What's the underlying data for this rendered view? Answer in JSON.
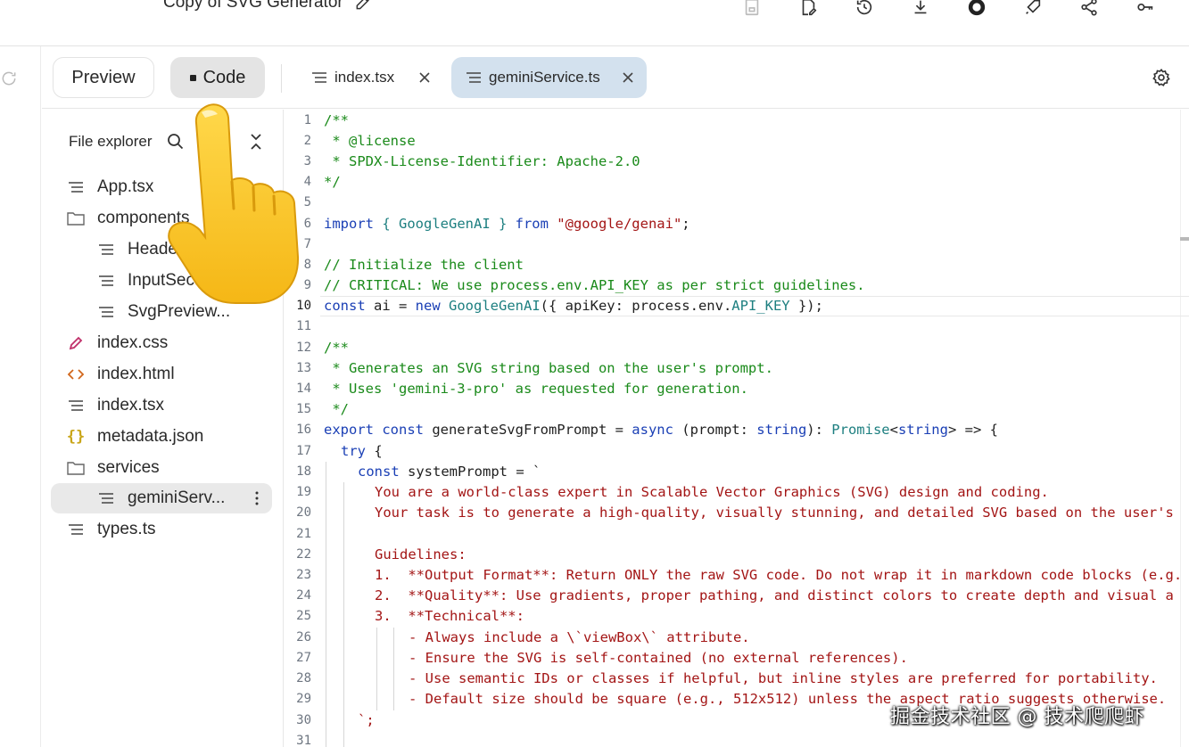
{
  "app": {
    "title": "Copy of SVG Generator",
    "top_icons": [
      "save-icon",
      "edit-file-icon",
      "history-icon",
      "download-icon",
      "github-icon",
      "deploy-rocket-icon",
      "share-icon",
      "key-icon"
    ]
  },
  "toolbar": {
    "preview_label": "Preview",
    "code_label": "Code"
  },
  "tabs": [
    {
      "label": "index.tsx",
      "active": false
    },
    {
      "label": "geminiService.ts",
      "active": true
    }
  ],
  "explorer": {
    "title": "File explorer",
    "items": [
      {
        "label": "App.tsx",
        "icon": "file-lines-icon",
        "indent": 0
      },
      {
        "label": "components",
        "icon": "folder-icon",
        "indent": 0
      },
      {
        "label": "Header.tsx",
        "icon": "file-lines-icon",
        "indent": 1
      },
      {
        "label": "InputSection.tsx",
        "icon": "file-lines-icon",
        "indent": 1
      },
      {
        "label": "SvgPreview...",
        "icon": "file-lines-icon",
        "indent": 1
      },
      {
        "label": "index.css",
        "icon": "pencil-file-icon",
        "indent": 0
      },
      {
        "label": "index.html",
        "icon": "html-brackets-icon",
        "indent": 0
      },
      {
        "label": "index.tsx",
        "icon": "file-lines-icon",
        "indent": 0
      },
      {
        "label": "metadata.json",
        "icon": "json-braces-icon",
        "indent": 0
      },
      {
        "label": "services",
        "icon": "folder-icon",
        "indent": 0
      },
      {
        "label": "geminiServ...",
        "icon": "file-lines-icon",
        "indent": 1,
        "selected": true
      },
      {
        "label": "types.ts",
        "icon": "file-lines-icon",
        "indent": 0
      }
    ]
  },
  "editor": {
    "current_line": 10,
    "line_numbers": [
      "1",
      "2",
      "3",
      "4",
      "5",
      "6",
      "7",
      "8",
      "9",
      "10",
      "11",
      "12",
      "13",
      "14",
      "15",
      "16",
      "17",
      "18",
      "19",
      "20",
      "21",
      "22",
      "23",
      "24",
      "25",
      "26",
      "27",
      "28",
      "29",
      "30",
      "31"
    ],
    "lines": {
      "l1": "/**",
      "l2": " * @license",
      "l3": " * SPDX-License-Identifier: Apache-2.0",
      "l4": "*/",
      "l6_a": "import",
      "l6_b": " { GoogleGenAI } ",
      "l6_c": "from",
      "l6_d": " \"@google/genai\"",
      "l6_e": ";",
      "l8": "// Initialize the client",
      "l9": "// CRITICAL: We use process.env.API_KEY as per strict guidelines.",
      "l10_a": "const",
      "l10_b": " ai = ",
      "l10_c": "new",
      "l10_d": " GoogleGenAI",
      "l10_e": "({ apiKey: process.env.",
      "l10_f": "API_KEY",
      "l10_g": " });",
      "l12": "/**",
      "l13": " * Generates an SVG string based on the user's prompt.",
      "l14": " * Uses 'gemini-3-pro' as requested for generation.",
      "l15": " */",
      "l16_a": "export const",
      "l16_b": " generateSvgFromPrompt = ",
      "l16_c": "async",
      "l16_d": " (prompt: ",
      "l16_e": "string",
      "l16_f": "): ",
      "l16_g": "Promise",
      "l16_h": "<",
      "l16_i": "string",
      "l16_j": "> => {",
      "l17": "try",
      "l17_b": " {",
      "l18_a": "const",
      "l18_b": " systemPrompt = `",
      "l19": "You are a world-class expert in Scalable Vector Graphics (SVG) design and coding.",
      "l20": "Your task is to generate a high-quality, visually stunning, and detailed SVG based on the user's",
      "l22": "Guidelines:",
      "l23": "1.  **Output Format**: Return ONLY the raw SVG code. Do not wrap it in markdown code blocks (e.g.",
      "l24": "2.  **Quality**: Use gradients, proper pathing, and distinct colors to create depth and visual a",
      "l25": "3.  **Technical**:",
      "l26": "- Always include a \\`viewBox\\` attribute.",
      "l27": "- Ensure the SVG is self-contained (no external references).",
      "l28": "- Use semantic IDs or classes if helpful, but inline styles are preferred for portability.",
      "l29": "- Default size should be square (e.g., 512x512) unless the aspect ratio suggests otherwise.",
      "l30": "`;"
    }
  },
  "watermark": "掘金技术社区 @ 技术爬爬虾"
}
